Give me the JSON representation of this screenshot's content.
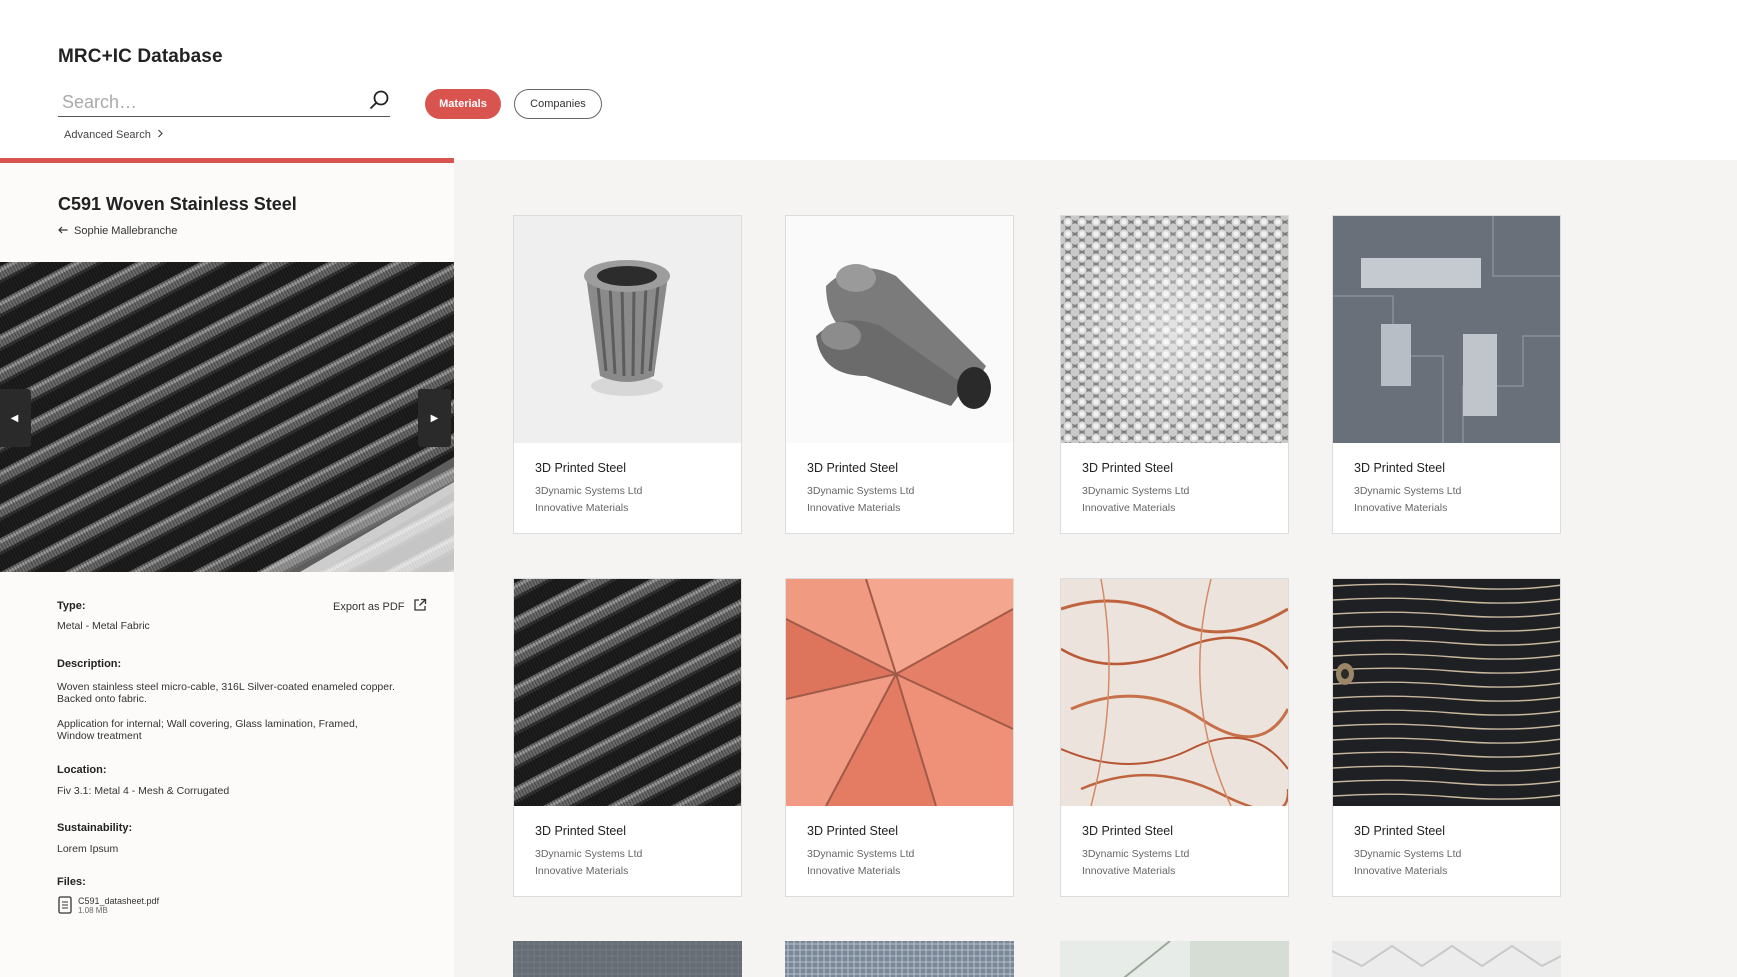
{
  "app": {
    "title": "MRC+IC Database"
  },
  "search": {
    "placeholder": "Search…",
    "advanced_label": "Advanced Search"
  },
  "filters": {
    "materials": "Materials",
    "companies": "Companies"
  },
  "detail": {
    "title": "C591 Woven Stainless Steel",
    "back_label": "Sophie Mallebranche",
    "export_label": "Export as PDF",
    "type_label": "Type:",
    "type_value": "Metal - Metal Fabric",
    "description_label": "Description:",
    "description_1": "Woven stainless steel micro-cable, 316L Silver-coated enameled copper. Backed onto fabric.",
    "description_2": "Application for internal; Wall covering, Glass lamination, Framed, Window treatment",
    "location_label": "Location:",
    "location_value": "Fiv 3.1: Metal 4 - Mesh & Corrugated",
    "sustainability_label": "Sustainability:",
    "sustainability_value": "Lorem Ipsum",
    "files_label": "Files:",
    "file_name": "C591_datasheet.pdf",
    "file_size": "1.08 MB"
  },
  "cards": [
    {
      "title": "3D Printed Steel",
      "company": "3Dynamic Systems Ltd",
      "category": "Innovative Materials",
      "image": "printed-steel-cylinder"
    },
    {
      "title": "3D Printed Steel",
      "company": "3Dynamic Systems Ltd",
      "category": "Innovative Materials",
      "image": "printed-steel-manifold"
    },
    {
      "title": "3D Printed Steel",
      "company": "3Dynamic Systems Ltd",
      "category": "Innovative Materials",
      "image": "hexagon-mesh"
    },
    {
      "title": "3D Printed Steel",
      "company": "3Dynamic Systems Ltd",
      "category": "Innovative Materials",
      "image": "steel-blocks"
    },
    {
      "title": "3D Printed Steel",
      "company": "3Dynamic Systems Ltd",
      "category": "Innovative Materials",
      "image": "woven-steel"
    },
    {
      "title": "3D Printed Steel",
      "company": "3Dynamic Systems Ltd",
      "category": "Innovative Materials",
      "image": "coral-faceted"
    },
    {
      "title": "3D Printed Steel",
      "company": "3Dynamic Systems Ltd",
      "category": "Innovative Materials",
      "image": "copper-mesh-fabric"
    },
    {
      "title": "3D Printed Steel",
      "company": "3Dynamic Systems Ltd",
      "category": "Innovative Materials",
      "image": "charred-wood"
    }
  ]
}
